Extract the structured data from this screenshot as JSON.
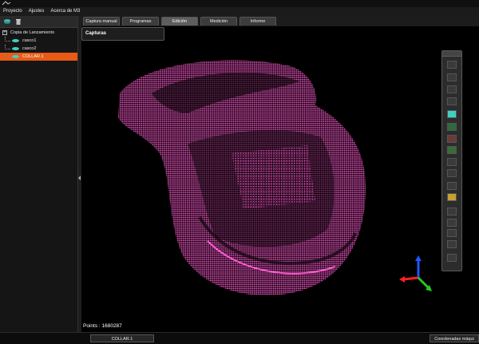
{
  "menu": [
    "Proyecto",
    "Ajustes",
    "Acerca de M3"
  ],
  "tree": [
    {
      "label": "Copia de Lanzamiento",
      "root": true,
      "selected": false
    },
    {
      "label": "casco1",
      "root": false,
      "selected": false
    },
    {
      "label": "casco2",
      "root": false,
      "selected": false
    },
    {
      "label": "COLLAR.1",
      "root": false,
      "selected": true
    }
  ],
  "tabs": [
    {
      "label": "Captura manual",
      "active": false
    },
    {
      "label": "Programas",
      "active": false
    },
    {
      "label": "Edición",
      "active": true
    },
    {
      "label": "Medición",
      "active": false
    },
    {
      "label": "Informe",
      "active": false
    }
  ],
  "panel": {
    "title": "Capturas"
  },
  "viewport": {
    "points_label": "Points : 1680287",
    "cloud_color": "#ff5ad0"
  },
  "status": {
    "left": "COLLAR.1",
    "right": "Coordenadas máqui"
  },
  "colors": {
    "selection": "#e85a16",
    "accent": "#3fd0c0"
  }
}
